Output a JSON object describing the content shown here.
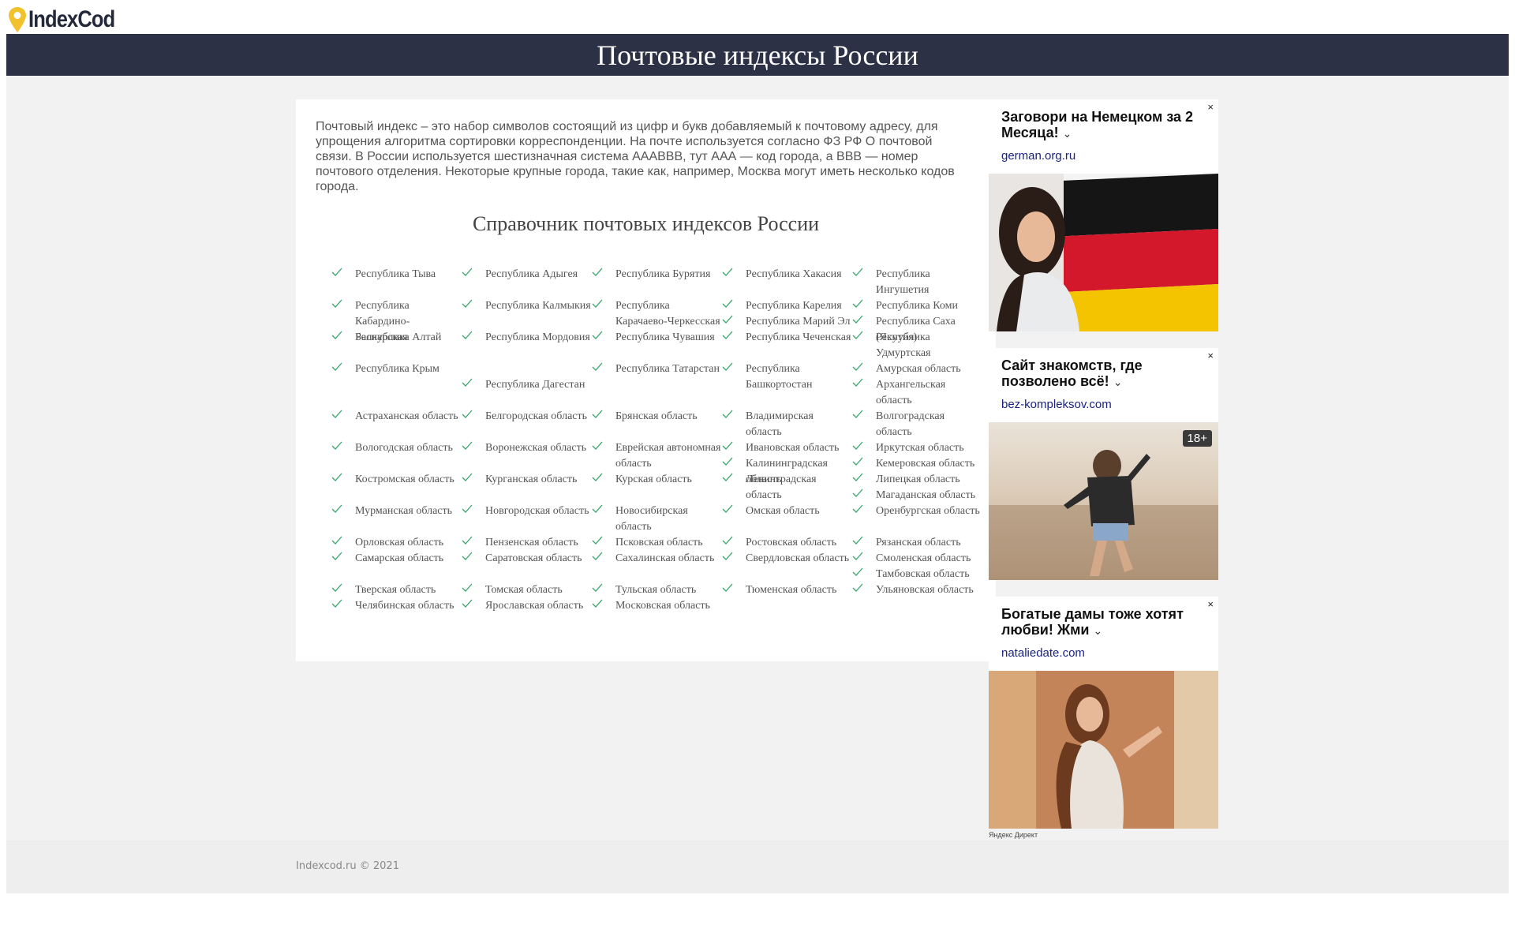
{
  "logo": {
    "text": "IndexCod",
    "accent": "#f2c12e"
  },
  "banner": {
    "title": "Почтовые индексы России",
    "bg": "#2c3146"
  },
  "intro": "Почтовый индекс – это набор символов состоящий из цифр и букв добавляемый к почтовому адресу, для упрощения алгоритма сортировки корреспонденции. На почте используется согласно ФЗ РФ О почтовой связи. В России используется шестизначная система АААВВВ, тут ААА — код города, а ВВВ — номер почтового отделения. Некоторые крупные города, такие как, например, Москва могут иметь несколько кодов города.",
  "directory_title": "Справочник почтовых индексов России",
  "check_icon": "check-icon",
  "regions": [
    "Республика Тыва",
    "Республика Адыгея",
    "Республика Бурятия",
    "Республика Хакасия",
    "Республика Ингушетия",
    "Республика Кабардино-Балкарская",
    "Республика Калмыкия",
    "Республика Карачаево-Черкесская",
    "Республика Карелия",
    "Республика Коми",
    "Республика Марий Эл",
    "Республика Саха (Якутия)",
    "Республика Алтай",
    "Республика Мордовия",
    "Республика Чувашия",
    "Республика Чеченская",
    "Республика Удмуртская",
    "Республика Крым",
    "Республика Дагестан",
    "Республика Татарстан",
    "Республика Башкортостан",
    "Амурская область",
    "Архангельская область",
    "Астраханская область",
    "Белгородская область",
    "Брянская область",
    "Владимирская область",
    "Волгоградская область",
    "Вологодская область",
    "Воронежская область",
    "Еврейская автономная область",
    "Ивановская область",
    "Иркутская область",
    "Калининградская область",
    "Кемеровская область",
    "Кировская область",
    "Костромская область",
    "Курганская область",
    "Курская область",
    "Ленинградская область",
    "Липецкая область",
    "Магаданская область",
    "Мурманская область",
    "Новгородская область",
    "Новосибирская область",
    "Омская область",
    "Оренбургская область",
    "Орловская область",
    "Пензенская область",
    "Псковская область",
    "Ростовская область",
    "Рязанская область",
    "Самарская область",
    "Саратовская область",
    "Сахалинская область",
    "Свердловская область",
    "Смоленская область",
    "Тамбовская область",
    "Тверская область",
    "Томская область",
    "Тульская область",
    "Тюменская область",
    "Ульяновская область",
    "Челябинская область",
    "Ярославская область",
    "Московская область"
  ],
  "ads": [
    {
      "title": "Заговори на Немецком за 2 Месяца!",
      "domain": "german.org.ru",
      "close": "×",
      "image": "woman-with-german-flag"
    },
    {
      "title": "Сайт знакомств, где позволено всё!",
      "domain": "bez-kompleksov.com",
      "close": "×",
      "age": "18+",
      "image": "woman-dancing-on-beach"
    },
    {
      "title": "Богатые дамы тоже хотят любви! Жми",
      "domain": "nataliedate.com",
      "close": "×",
      "image": "woman-in-white-dress"
    }
  ],
  "ad_label": "Яндекс Директ",
  "footer": {
    "copyright": "Indexcod.ru © 2021"
  }
}
